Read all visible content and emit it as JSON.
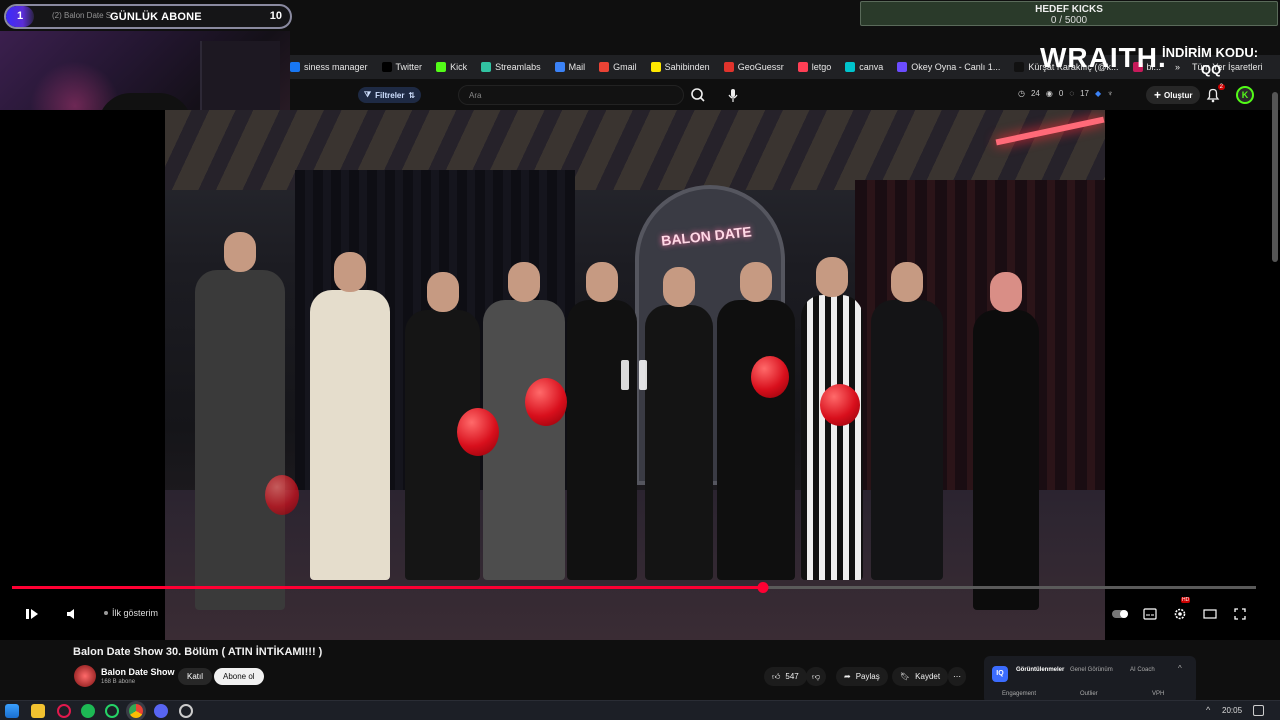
{
  "overlay": {
    "sub_goal": {
      "count": "1",
      "title": "GÜNLÜK ABONE",
      "target": "10",
      "ghost_tab": "(2) Balon Date S...",
      "progress": 0.1
    },
    "kick_goal": {
      "title": "HEDEF KICKS",
      "value": "0 / 5000"
    },
    "sponsor": {
      "logo": "WRAITH.",
      "code_label": "İNDİRİM KODU:",
      "code": "QQ"
    }
  },
  "bookmarks": [
    {
      "label": "siness manager",
      "color": "#1877f2"
    },
    {
      "label": "Twitter",
      "color": "#000000"
    },
    {
      "label": "Kick",
      "color": "#53fc18"
    },
    {
      "label": "Streamlabs",
      "color": "#31c3a2"
    },
    {
      "label": "Mail",
      "color": "#3b82f6"
    },
    {
      "label": "Gmail",
      "color": "#ea4335"
    },
    {
      "label": "Sahibinden",
      "color": "#ffe800"
    },
    {
      "label": "GeoGuessr",
      "color": "#e0332c"
    },
    {
      "label": "letgo",
      "color": "#ff3f55"
    },
    {
      "label": "canva",
      "color": "#00c4cc"
    },
    {
      "label": "Okey Oyna - Canlı 1...",
      "color": "#6b4cff"
    },
    {
      "label": "Kürşat Karakılıç (@k...",
      "color": "#111111"
    },
    {
      "label": "bi...",
      "color": "#c61a5a"
    }
  ],
  "bookmarks_more": "»",
  "bookmarks_other": "Tüm Yer İşaretleri",
  "yt": {
    "filter_label": "Filtreler",
    "search_placeholder": "Ara",
    "stats": {
      "views": "24",
      "likes": "0",
      "comments": "17"
    },
    "create_label": "Oluştur",
    "notif_count": "2",
    "avatar_letter": "K"
  },
  "scene": {
    "sign_text": "BALON DATE"
  },
  "player": {
    "progress": 0.6,
    "chapter": "İlk gösterim",
    "hd_badge": "HD"
  },
  "video": {
    "title": "Balon Date Show 30. Bölüm ( ATIN İNTİKAMI!!! )",
    "channel": "Balon Date Show",
    "subs": "168 B abone",
    "join_label": "Katıl",
    "subscribe_label": "Abone ol",
    "likes": "547",
    "share_label": "Paylaş",
    "save_label": "Kaydet",
    "more": "⋯"
  },
  "vidiq": {
    "logo": "IQ",
    "tabs": [
      "Görüntülenmeler",
      "Genel Görünüm",
      "AI Coach"
    ],
    "sub_tabs": [
      "Engagement",
      "Outlier",
      "VPH"
    ]
  },
  "taskbar": {
    "time": "20:05",
    "tray": "^"
  }
}
